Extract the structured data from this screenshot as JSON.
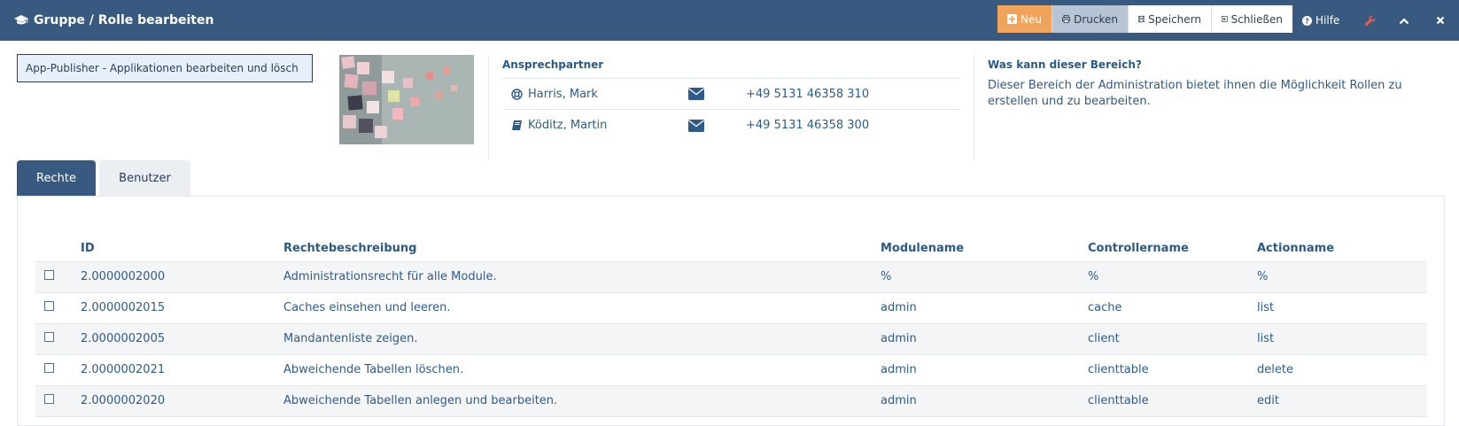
{
  "header": {
    "title": "Gruppe / Rolle bearbeiten",
    "actions": {
      "new": "Neu",
      "print": "Drucken",
      "save": "Speichern",
      "close": "Schließen"
    },
    "help": "Hilfe",
    "colors": {
      "bar": "#395a80",
      "new_button": "#f0a35a",
      "print_button": "#b7c4d3",
      "wrench": "#e2574c"
    }
  },
  "group": {
    "value": "App-Publisher - Applikationen bearbeiten und lösch"
  },
  "contacts": {
    "heading": "Ansprechpartner",
    "items": [
      {
        "name": "Harris, Mark",
        "phone": "+49 5131 46358 310",
        "icon": "lifebuoy-icon"
      },
      {
        "name": "Köditz, Martin",
        "phone": "+49 5131 46358 300",
        "icon": "book-icon"
      }
    ]
  },
  "info": {
    "heading": "Was kann dieser Bereich?",
    "text": "Dieser Bereich der Administration bietet ihnen die Möglichkeit Rollen zu erstellen und zu bearbeiten."
  },
  "tabs": [
    {
      "label": "Rechte",
      "active": true
    },
    {
      "label": "Benutzer",
      "active": false
    }
  ],
  "table": {
    "columns": [
      "ID",
      "Rechtebeschreibung",
      "Modulename",
      "Controllername",
      "Actionname"
    ],
    "rows": [
      {
        "id": "2.0000002000",
        "desc": "Administrationsrecht für alle Module.",
        "module": "%",
        "controller": "%",
        "action": "%"
      },
      {
        "id": "2.0000002015",
        "desc": "Caches einsehen und leeren.",
        "module": "admin",
        "controller": "cache",
        "action": "list"
      },
      {
        "id": "2.0000002005",
        "desc": "Mandantenliste zeigen.",
        "module": "admin",
        "controller": "client",
        "action": "list"
      },
      {
        "id": "2.0000002021",
        "desc": "Abweichende Tabellen löschen.",
        "module": "admin",
        "controller": "clienttable",
        "action": "delete"
      },
      {
        "id": "2.0000002020",
        "desc": "Abweichende Tabellen anlegen und bearbeiten.",
        "module": "admin",
        "controller": "clienttable",
        "action": "edit"
      }
    ]
  }
}
